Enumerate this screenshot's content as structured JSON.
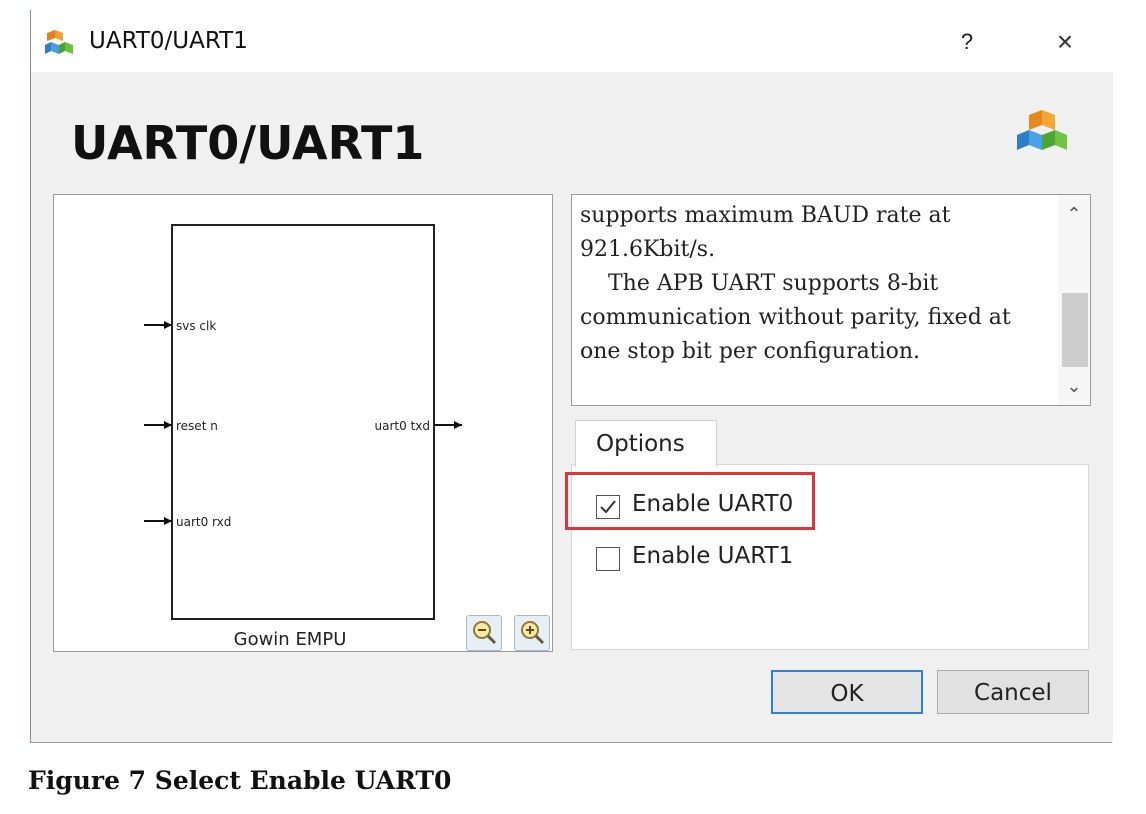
{
  "window": {
    "title": "UART0/UART1",
    "help_label": "?",
    "close_label": "×"
  },
  "heading": "UART0/UART1",
  "diagram": {
    "ports_in": [
      "svs clk",
      "reset n",
      "uart0 rxd"
    ],
    "ports_out": [
      "uart0 txd"
    ],
    "block_label": "Gowin EMPU"
  },
  "description": {
    "line1": "supports maximum BAUD rate at 921.6Kbit/s.",
    "line2": "The APB UART supports 8-bit communication without parity, fixed at one stop bit per configuration."
  },
  "options": {
    "tab_label": "Options",
    "items": [
      {
        "label": "Enable UART0",
        "checked": true
      },
      {
        "label": "Enable UART1",
        "checked": false
      }
    ]
  },
  "buttons": {
    "ok": "OK",
    "cancel": "Cancel"
  },
  "caption": "Figure 7 Select Enable UART0",
  "colors": {
    "highlight": "#d9383a",
    "ok_border": "#2f7fd2"
  },
  "icons": [
    "cubes-icon",
    "help-icon",
    "close-icon",
    "zoom-out-icon",
    "zoom-in-icon",
    "chevron-up-icon",
    "chevron-down-icon",
    "checkmark-icon"
  ]
}
